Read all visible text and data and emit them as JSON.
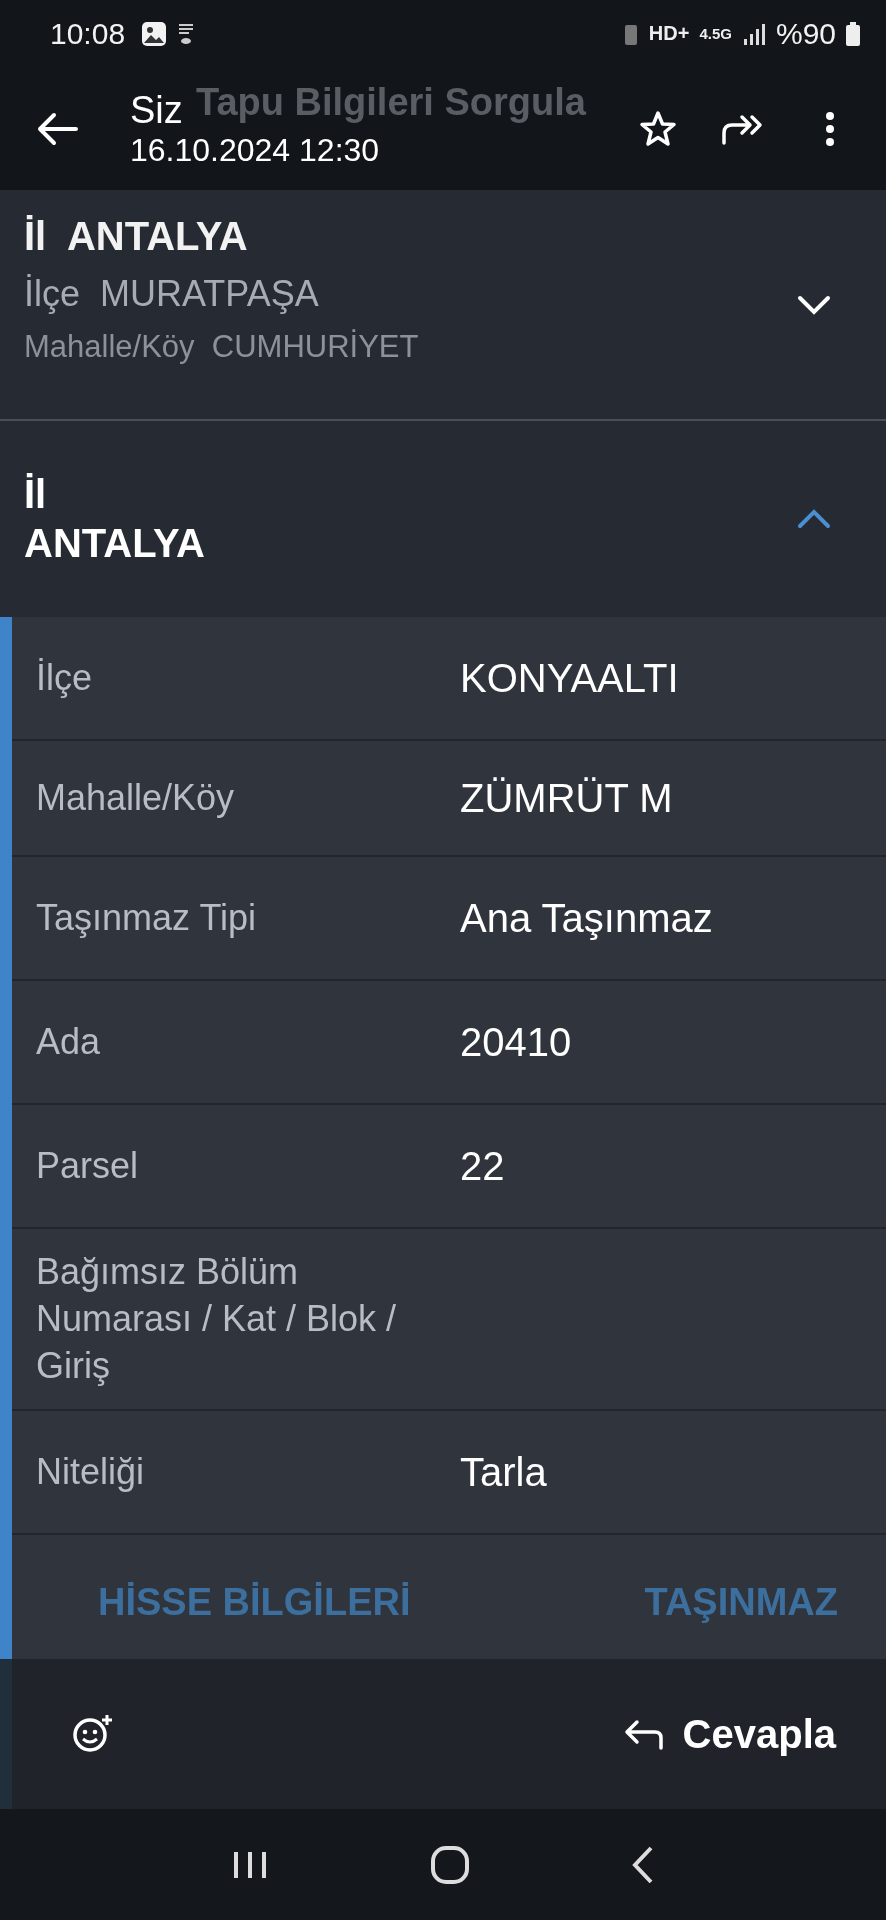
{
  "status_bar": {
    "time": "10:08",
    "hd": "HD+",
    "network": "4.5G",
    "battery": "%90"
  },
  "header": {
    "sender": "Siz",
    "timestamp": "16.10.2024 12:30",
    "background_title": "Tapu Bilgileri Sorgula"
  },
  "summary": {
    "province_label": "İl",
    "province": "ANTALYA",
    "district_label": "İlçe",
    "district": "MURATPAŞA",
    "neighborhood_label": "Mahalle/Köy",
    "neighborhood": "CUMHURİYET",
    "expanded": false
  },
  "detail": {
    "province_label": "İl",
    "province": "ANTALYA",
    "expanded": true,
    "rows": [
      {
        "label": "İlçe",
        "value": "KONYAALTI"
      },
      {
        "label": "Mahalle/Köy",
        "value": "ZÜMRÜT M"
      },
      {
        "label": "Taşınmaz Tipi",
        "value": "Ana Taşınmaz"
      },
      {
        "label": "Ada",
        "value": "20410"
      },
      {
        "label": "Parsel",
        "value": "22"
      },
      {
        "label": "Bağımsız Bölüm Numarası / Kat / Blok / Giriş"
      },
      {
        "label": "Niteliği",
        "value": "Tarla"
      }
    ]
  },
  "tabs": [
    {
      "label": "HİSSE BİLGİLERİ"
    },
    {
      "label": "TAŞINMAZ"
    }
  ],
  "reply_button": "Cevapla"
}
